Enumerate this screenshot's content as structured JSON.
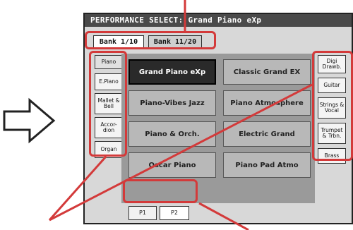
{
  "title": "PERFORMANCE SELECT: Grand Piano eXp",
  "bank_tabs": [
    "Bank 1/10",
    "Bank 11/20"
  ],
  "left_groups": [
    "Piano",
    "E.Piano",
    "Mallet & Bell",
    "Accor-dion",
    "Organ"
  ],
  "right_groups": [
    "Digi Drawb.",
    "Guitar",
    "Strings & Vocal",
    "Trumpet & Trbn.",
    "Brass"
  ],
  "performances": [
    "Grand Piano eXp",
    "Classic Grand EX",
    "Piano-Vibes Jazz",
    "Piano Atmosphere",
    "Piano & Orch.",
    "Electric Grand",
    "Oscar Piano",
    "Piano Pad Atmo"
  ],
  "pages": [
    "P1",
    "P2"
  ],
  "colors": {
    "highlight": "#d33a3a",
    "selected": "#2a2a2a",
    "title_bg": "#4a4a4a"
  },
  "icons": {
    "pointer_arrow": "outlined-right-arrow-icon"
  }
}
